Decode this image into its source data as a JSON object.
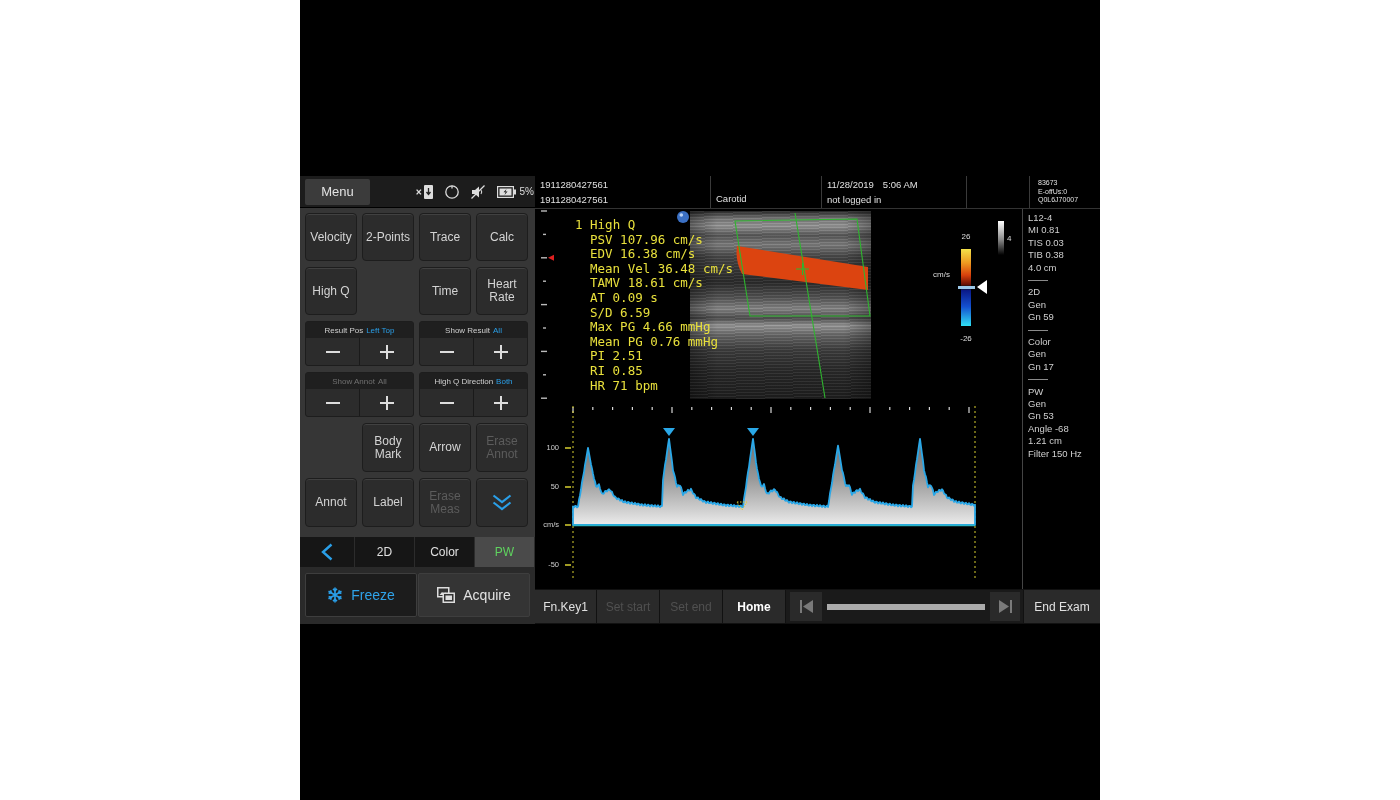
{
  "status_bar": {
    "menu_button": "Menu",
    "battery_percent": "5%"
  },
  "tool_grid": [
    {
      "kind": "button",
      "label": "Velocity",
      "disabled": false
    },
    {
      "kind": "button",
      "label": "2-Points",
      "disabled": false
    },
    {
      "kind": "button",
      "label": "Trace",
      "disabled": false
    },
    {
      "kind": "button",
      "label": "Calc",
      "disabled": false
    },
    {
      "kind": "button",
      "label": "High Q",
      "disabled": false
    },
    {
      "kind": "blank"
    },
    {
      "kind": "button",
      "label": "Time",
      "disabled": false
    },
    {
      "kind": "button",
      "label": "Heart Rate",
      "disabled": false
    }
  ],
  "adjusters": [
    {
      "label": "Result Pos",
      "value": "Left Top",
      "disabled": false
    },
    {
      "label": "Show Result",
      "value": "All",
      "disabled": false
    },
    {
      "label": "Show Annot",
      "value": "All",
      "disabled": true
    },
    {
      "label": "High Q Direction",
      "value": "Both",
      "disabled": false
    }
  ],
  "tool_grid_lower": [
    {
      "kind": "blank"
    },
    {
      "kind": "button",
      "label": "Body Mark",
      "disabled": false
    },
    {
      "kind": "button",
      "label": "Arrow",
      "disabled": false
    },
    {
      "kind": "button",
      "label": "Erase Annot",
      "disabled": true
    },
    {
      "kind": "button",
      "label": "Annot",
      "disabled": false
    },
    {
      "kind": "button",
      "label": "Label",
      "disabled": false
    },
    {
      "kind": "button",
      "label": "Erase Meas",
      "disabled": true
    },
    {
      "kind": "more"
    }
  ],
  "mode_tabs": [
    {
      "label": "2D",
      "selected": false
    },
    {
      "label": "Color",
      "selected": false
    },
    {
      "label": "PW",
      "selected": true
    }
  ],
  "capture_buttons": [
    {
      "kind": "freeze",
      "label": "Freeze"
    },
    {
      "kind": "acquire",
      "label": "Acquire"
    }
  ],
  "header": {
    "ids": [
      "1911280427561",
      "1911280427561"
    ],
    "exam": "Carotid",
    "date": "11/28/2019",
    "time": "5:06 AM",
    "operator": "not logged in",
    "device_info": [
      "83673",
      "E-offUs:0",
      "Q0L6J70007"
    ]
  },
  "measurements": {
    "title": "1 High Q",
    "lines": [
      "PSV 107.96 cm/s",
      "EDV 16.38 cm/s",
      "Mean Vel 36.48 cm/s",
      "TAMV 18.61 cm/s",
      "AT 0.09 s",
      "S/D 6.59",
      "Max PG 4.66 mmHg",
      "Mean PG 0.76 mmHg",
      "PI 2.51",
      "RI 0.85",
      "HR 71 bpm"
    ]
  },
  "color_scale": {
    "max": "26",
    "unit": "cm/s",
    "min": "-26"
  },
  "gray_scale": {
    "label": "4"
  },
  "spectrum": {
    "scale_labels": [
      "100",
      "50",
      "cm/s",
      "-50"
    ]
  },
  "parameter_groups": [
    {
      "lines": [
        "L12-4",
        "MI 0.81",
        "TIS 0.03",
        "TIB 0.38",
        "4.0 cm"
      ]
    },
    {
      "lines": [
        "2D",
        "Gen",
        "Gn 59"
      ]
    },
    {
      "lines": [
        "Color",
        "Gen",
        "Gn 17"
      ]
    },
    {
      "lines": [
        "PW",
        "Gen",
        "Gn 53",
        "Angle -68",
        "1.21 cm",
        "Filter 150 Hz"
      ]
    }
  ],
  "bottom_bar": {
    "keys": [
      {
        "kind": "softkey",
        "label": "Fn.Key1",
        "disabled": false
      },
      {
        "kind": "softkey",
        "label": "Set start",
        "disabled": true
      },
      {
        "kind": "softkey",
        "label": "Set end",
        "disabled": true
      },
      {
        "kind": "home",
        "label": "Home",
        "disabled": false
      }
    ],
    "end_button": "End Exam"
  }
}
